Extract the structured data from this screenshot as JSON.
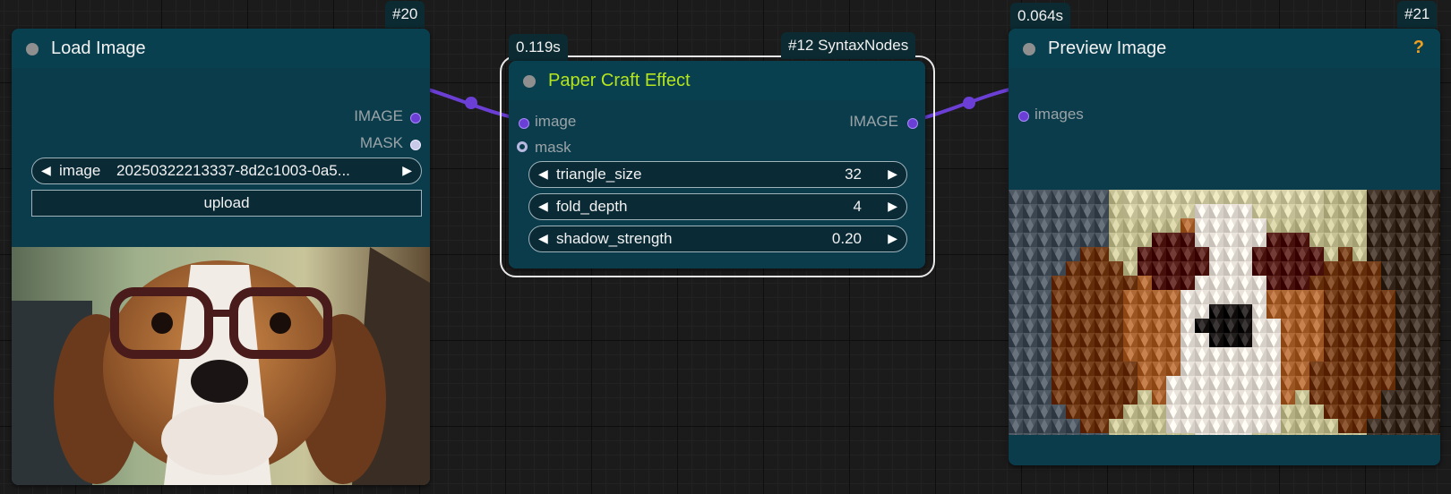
{
  "wires": {
    "color": "#6b3fd6"
  },
  "load_image": {
    "id_tag": "#20",
    "title": "Load Image",
    "outputs": {
      "image_label": "IMAGE",
      "mask_label": "MASK"
    },
    "image_widget": {
      "name": "image",
      "value": "20250322213337-8d2c1003-0a5..."
    },
    "upload_label": "upload",
    "preview_alt": "Beagle wearing glasses in car"
  },
  "paper_craft": {
    "time_tag": "0.119s",
    "source_tag": "#12 SyntaxNodes",
    "title": "Paper Craft Effect",
    "title_color": "#b5e61d",
    "inputs": {
      "image_label": "image",
      "mask_label": "mask"
    },
    "output_label": "IMAGE",
    "widgets": [
      {
        "name": "triangle_size",
        "value": "32"
      },
      {
        "name": "fold_depth",
        "value": "4"
      },
      {
        "name": "shadow_strength",
        "value": "0.20"
      }
    ]
  },
  "preview_image": {
    "time_tag": "0.064s",
    "id_tag": "#21",
    "title": "Preview Image",
    "help_icon": "?",
    "input_label": "images"
  }
}
